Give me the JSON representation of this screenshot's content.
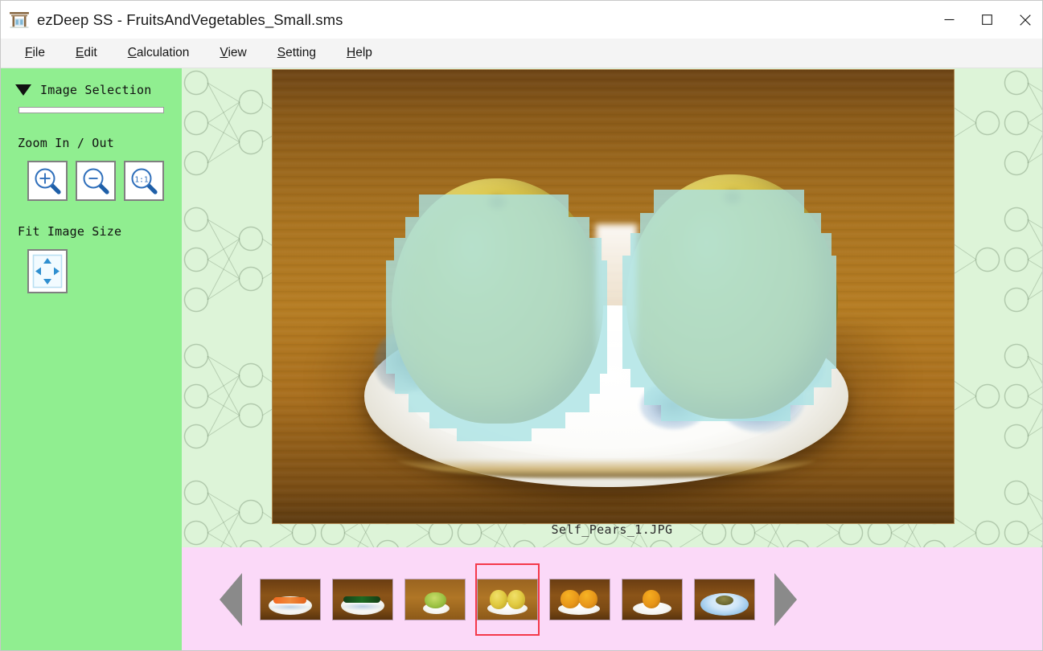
{
  "window": {
    "title": "ezDeep SS - FruitsAndVegetables_Small.sms",
    "app_icon": "torii-gate-icon",
    "controls": {
      "minimize": "minimize-icon",
      "maximize": "maximize-icon",
      "close": "close-icon"
    }
  },
  "menubar": {
    "items": [
      {
        "label": "File",
        "accel": "F"
      },
      {
        "label": "Edit",
        "accel": "E"
      },
      {
        "label": "Calculation",
        "accel": "C"
      },
      {
        "label": "View",
        "accel": "V"
      },
      {
        "label": "Setting",
        "accel": "S"
      },
      {
        "label": "Help",
        "accel": "H"
      }
    ]
  },
  "sidebar": {
    "section_title": "Image Selection",
    "collapse_icon": "triangle-down-icon",
    "zoom_group_label": "Zoom In / Out",
    "zoom_buttons": [
      {
        "name": "zoom-in-button",
        "icon": "magnifier-plus-icon",
        "glyph": "+"
      },
      {
        "name": "zoom-out-button",
        "icon": "magnifier-minus-icon",
        "glyph": "-"
      },
      {
        "name": "zoom-actual-size-button",
        "icon": "magnifier-one-to-one-icon",
        "glyph": "1:1"
      }
    ],
    "fit_group_label": "Fit Image Size",
    "fit_button": {
      "name": "fit-image-size-button",
      "icon": "four-arrows-expand-icon"
    },
    "background_color": "#90EE90"
  },
  "canvas": {
    "background_color": "#DDF4D8",
    "pattern": "neural-network-watermark",
    "image_caption": "Self_Pears_1.JPG",
    "segmentation_mask_color": "#AAE2E4",
    "photo": {
      "subject": "two yellow pears on a white floral plate on a wooden table",
      "plate_color": "#FFFFFF",
      "table_color": "#A8721F"
    }
  },
  "filmstrip": {
    "background_color": "#FBD9F8",
    "prev_arrow": "triangle-left-icon",
    "next_arrow": "triangle-right-icon",
    "selection_color": "#F4384A",
    "selected_index": 3,
    "thumbnails": [
      {
        "name": "thumbnail-carrot",
        "subject": "carrot on white plate"
      },
      {
        "name": "thumbnail-cucumber",
        "subject": "cucumber on white plate"
      },
      {
        "name": "thumbnail-lettuce",
        "subject": "lettuce on white plate"
      },
      {
        "name": "thumbnail-pears",
        "subject": "two pears on white plate"
      },
      {
        "name": "thumbnail-persimmons",
        "subject": "two persimmons on white plate"
      },
      {
        "name": "thumbnail-persimmon-single",
        "subject": "single persimmon on white plate"
      },
      {
        "name": "thumbnail-kiwi",
        "subject": "kiwi on blue plate"
      }
    ]
  }
}
